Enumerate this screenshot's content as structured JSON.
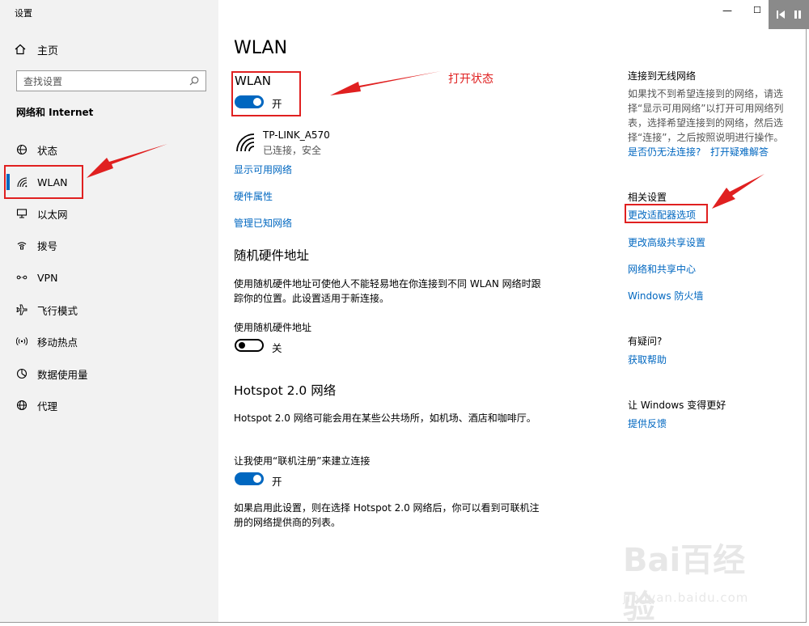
{
  "window": {
    "title": "设置",
    "minimize": "—",
    "maximize": "☐"
  },
  "sidebar": {
    "home_label": "主页",
    "search_placeholder": "查找设置",
    "section": "网络和 Internet",
    "items": [
      {
        "label": "状态",
        "icon": "globe-status-icon"
      },
      {
        "label": "WLAN",
        "icon": "wifi-icon",
        "selected": true
      },
      {
        "label": "以太网",
        "icon": "ethernet-icon"
      },
      {
        "label": "拨号",
        "icon": "dialup-icon"
      },
      {
        "label": "VPN",
        "icon": "vpn-icon"
      },
      {
        "label": "飞行模式",
        "icon": "airplane-icon"
      },
      {
        "label": "移动热点",
        "icon": "hotspot-icon"
      },
      {
        "label": "数据使用量",
        "icon": "data-usage-icon"
      },
      {
        "label": "代理",
        "icon": "globe-icon"
      }
    ]
  },
  "main": {
    "title": "WLAN",
    "wlan_heading": "WLAN",
    "wlan_toggle": {
      "state": "on",
      "label": "开"
    },
    "network": {
      "name": "TP-LINK_A570",
      "status": "已连接，安全"
    },
    "links": [
      "显示可用网络",
      "硬件属性",
      "管理已知网络"
    ],
    "random_hw": {
      "heading": "随机硬件地址",
      "desc": "使用随机硬件地址可使他人不能轻易地在你连接到不同 WLAN 网络时跟踪你的位置。此设置适用于新连接。",
      "toggle_caption": "使用随机硬件地址",
      "toggle": {
        "state": "off",
        "label": "关"
      }
    },
    "hotspot": {
      "heading": "Hotspot 2.0 网络",
      "desc": "Hotspot 2.0 网络可能会用在某些公共场所，如机场、酒店和咖啡厅。",
      "toggle_caption": "让我使用“联机注册”来建立连接",
      "toggle": {
        "state": "on",
        "label": "开"
      },
      "footer": "如果启用此设置，则在选择 Hotspot 2.0 网络后，你可以看到可联机注册的网络提供商的列表。"
    }
  },
  "right": {
    "connect": {
      "heading": "连接到无线网络",
      "desc": "如果找不到希望连接到的网络，请选择“显示可用网络”以打开可用网络列表，选择希望连接到的网络，然后选择“连接”，之后按照说明进行操作。",
      "link1": "是否仍无法连接?",
      "link2": "打开疑难解答"
    },
    "related": {
      "heading": "相关设置",
      "links": [
        "更改适配器选项",
        "更改高级共享设置",
        "网络和共享中心",
        "Windows 防火墙"
      ]
    },
    "question": {
      "heading": "有疑问?",
      "link": "获取帮助"
    },
    "better": {
      "heading": "让 Windows 变得更好",
      "link": "提供反馈"
    }
  },
  "annotation": {
    "text": "打开状态",
    "color": "#e02020"
  },
  "watermark": {
    "big": "Bai百经验",
    "small": "jingyan.baidu.com"
  },
  "colors": {
    "accent": "#0067c0",
    "sidebar_bg": "#f2f2f2"
  }
}
